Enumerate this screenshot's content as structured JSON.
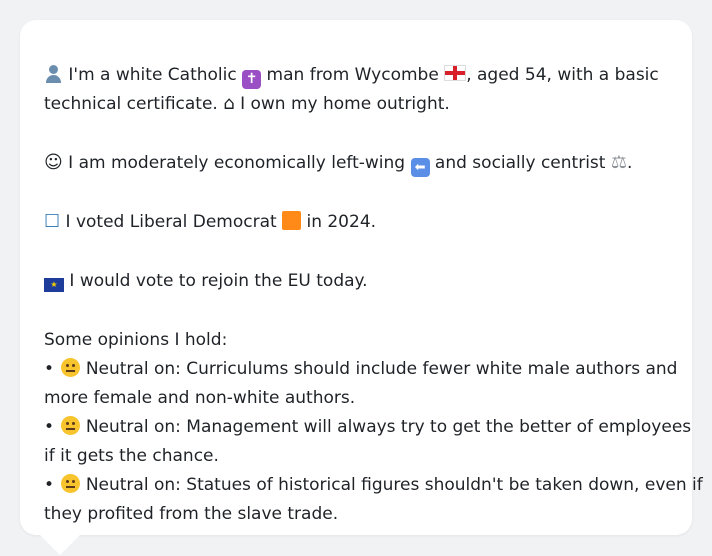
{
  "intro": {
    "line1_pre": "I'm a white Catholic",
    "line1_mid": "man from Wycombe",
    "line1_post": ", aged 54, with a basic",
    "line2_pre": "technical certificate.",
    "line2_post": "I own my home outright.",
    "icons": [
      "user-icon",
      "latin-cross-icon",
      "england-flag-icon",
      "house-icon"
    ]
  },
  "politics": {
    "text_pre": "I am moderately economically left-wing",
    "text_mid": "and socially centrist",
    "text_post": ".",
    "icons": [
      "thinking-face-icon",
      "left-arrow-icon",
      "balance-scale-icon"
    ]
  },
  "vote": {
    "text_pre": "I voted Liberal Democrat",
    "text_post": "in 2024.",
    "icons": [
      "ballot-box-icon",
      "orange-square-icon"
    ]
  },
  "eu": {
    "text": "I would vote to rejoin the EU today.",
    "icons": [
      "eu-flag-icon"
    ]
  },
  "opinions": {
    "heading": "Some opinions I hold:",
    "bullet": "•",
    "items": [
      {
        "stance": "Neutral on:",
        "line1": "Curriculums should include fewer white male authors and",
        "line2": "more female and non-white authors."
      },
      {
        "stance": "Neutral on:",
        "line1": "Management will always try to get the better of employees",
        "line2": "if it gets the chance."
      },
      {
        "stance": "Neutral on:",
        "line1": "Statues of historical figures shouldn't be taken down, even if",
        "line2": "they profited from the slave trade."
      }
    ]
  },
  "colors": {
    "card": "#ffffff",
    "background": "#f1f2f4",
    "text": "#1f2328"
  }
}
